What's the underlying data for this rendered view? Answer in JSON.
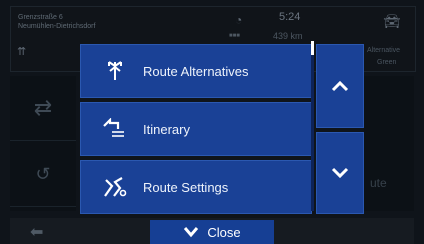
{
  "header": {
    "address_line1": "Grenzstraße 6",
    "address_line2": "Neumühlen-Dietrichsdorf",
    "time": "5:24",
    "distance": "439 km",
    "route_alt_label": "Alternative",
    "route_alt_color": "Green"
  },
  "menu": {
    "items": [
      {
        "label": "Route Alternatives",
        "icon": "route-alternatives-icon"
      },
      {
        "label": "Itinerary",
        "icon": "itinerary-icon"
      },
      {
        "label": "Route Settings",
        "icon": "route-settings-icon"
      }
    ],
    "scroll_up_icon": "chevron-up-icon",
    "scroll_down_icon": "chevron-down-icon"
  },
  "background": {
    "right_label_partial": "ute"
  },
  "footer": {
    "close_label": "Close"
  },
  "colors": {
    "menu_blue": "#1a4196",
    "close_blue": "#163f94",
    "background": "#0f141a"
  }
}
